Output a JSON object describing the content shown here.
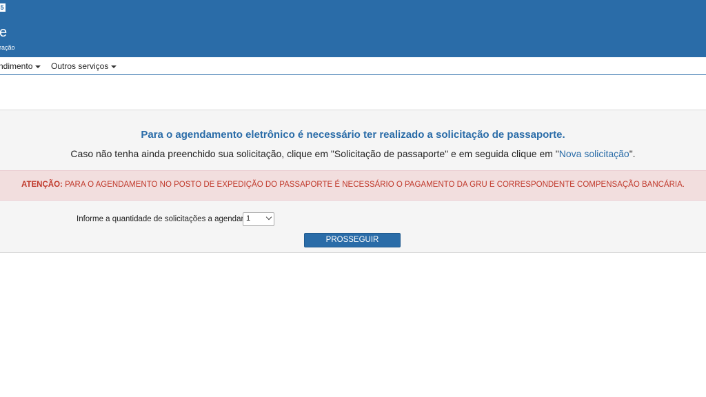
{
  "header": {
    "badge": "5",
    "title": "e",
    "subtitle": "ração",
    "background_color": "#2a6ca8"
  },
  "nav": {
    "items": [
      {
        "label": "ndimento",
        "has_dropdown": true
      },
      {
        "label": "Outros serviços",
        "has_dropdown": true
      }
    ]
  },
  "main": {
    "info_heading": "Para o agendamento eletrônico é necessário ter realizado a solicitação de passaporte.",
    "info_text_before": "Caso não tenha ainda preenchido sua solicitação, clique em \"Solicitação de passaporte\" e em seguida clique em \"",
    "info_link": "Nova solicitação",
    "info_text_after": "\".",
    "alert_label": "ATENÇÃO:",
    "alert_text": " PARA O AGENDAMENTO NO POSTO DE EXPEDIÇÃO DO PASSAPORTE É NECESSÁRIO O PAGAMENTO DA GRU E CORRESPONDENTE COMPENSAÇÃO BANCÁRIA.",
    "quantity_label": "Informe a quantidade de solicitações a agendar:",
    "quantity_value": "1",
    "proceed_button": "PROSSEGUIR",
    "accent_color": "#2a6ca8",
    "alert_color": "#c0392b"
  }
}
